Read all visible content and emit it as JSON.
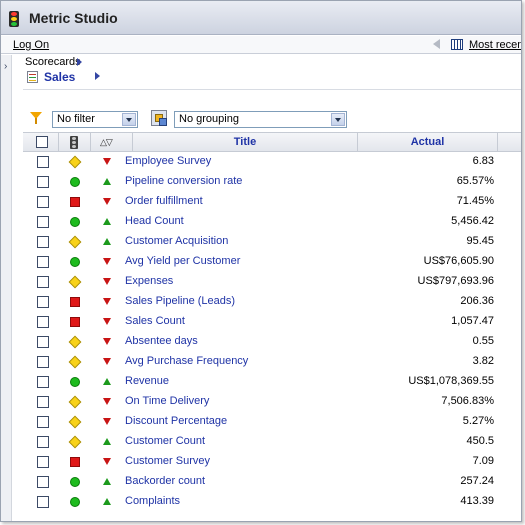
{
  "app": {
    "title": "Metric Studio"
  },
  "menubar": {
    "logon": "Log On",
    "most_recent": "Most recent"
  },
  "breadcrumb": {
    "parent": "Scorecards",
    "current": "Sales"
  },
  "toolbar": {
    "filter_value": "No filter",
    "grouping_value": "No grouping"
  },
  "table": {
    "columns": {
      "title": "Title",
      "actual": "Actual"
    },
    "rows": [
      {
        "status": "diamond",
        "trend": "down",
        "title": "Employee Survey",
        "actual": "6.83"
      },
      {
        "status": "circle",
        "trend": "up",
        "title": "Pipeline conversion rate",
        "actual": "65.57%"
      },
      {
        "status": "square",
        "trend": "down",
        "title": "Order fulfillment",
        "actual": "71.45%"
      },
      {
        "status": "circle",
        "trend": "up",
        "title": "Head Count",
        "actual": "5,456.42"
      },
      {
        "status": "diamond",
        "trend": "up",
        "title": "Customer Acquisition",
        "actual": "95.45"
      },
      {
        "status": "circle",
        "trend": "down",
        "title": "Avg Yield per Customer",
        "actual": "US$76,605.90"
      },
      {
        "status": "diamond",
        "trend": "down",
        "title": "Expenses",
        "actual": "US$797,693.96"
      },
      {
        "status": "square",
        "trend": "down",
        "title": "Sales Pipeline (Leads)",
        "actual": "206.36"
      },
      {
        "status": "square",
        "trend": "down",
        "title": "Sales Count",
        "actual": "1,057.47"
      },
      {
        "status": "diamond",
        "trend": "down",
        "title": "Absentee days",
        "actual": "0.55"
      },
      {
        "status": "diamond",
        "trend": "down",
        "title": "Avg Purchase Frequency",
        "actual": "3.82"
      },
      {
        "status": "circle",
        "trend": "up",
        "title": "Revenue",
        "actual": "US$1,078,369.55"
      },
      {
        "status": "diamond",
        "trend": "down",
        "title": "On Time Delivery",
        "actual": "7,506.83%"
      },
      {
        "status": "diamond",
        "trend": "down",
        "title": "Discount Percentage",
        "actual": "5.27%"
      },
      {
        "status": "diamond",
        "trend": "up",
        "title": "Customer Count",
        "actual": "450.5"
      },
      {
        "status": "square",
        "trend": "down",
        "title": "Customer Survey",
        "actual": "7.09"
      },
      {
        "status": "circle",
        "trend": "up",
        "title": "Backorder count",
        "actual": "257.24"
      },
      {
        "status": "circle",
        "trend": "up",
        "title": "Complaints",
        "actual": "413.39"
      }
    ]
  },
  "colors": {
    "link": "#1f33a6",
    "status_green": "#1fbb1f",
    "status_red": "#e01818",
    "status_yellow": "#f8d21a"
  }
}
